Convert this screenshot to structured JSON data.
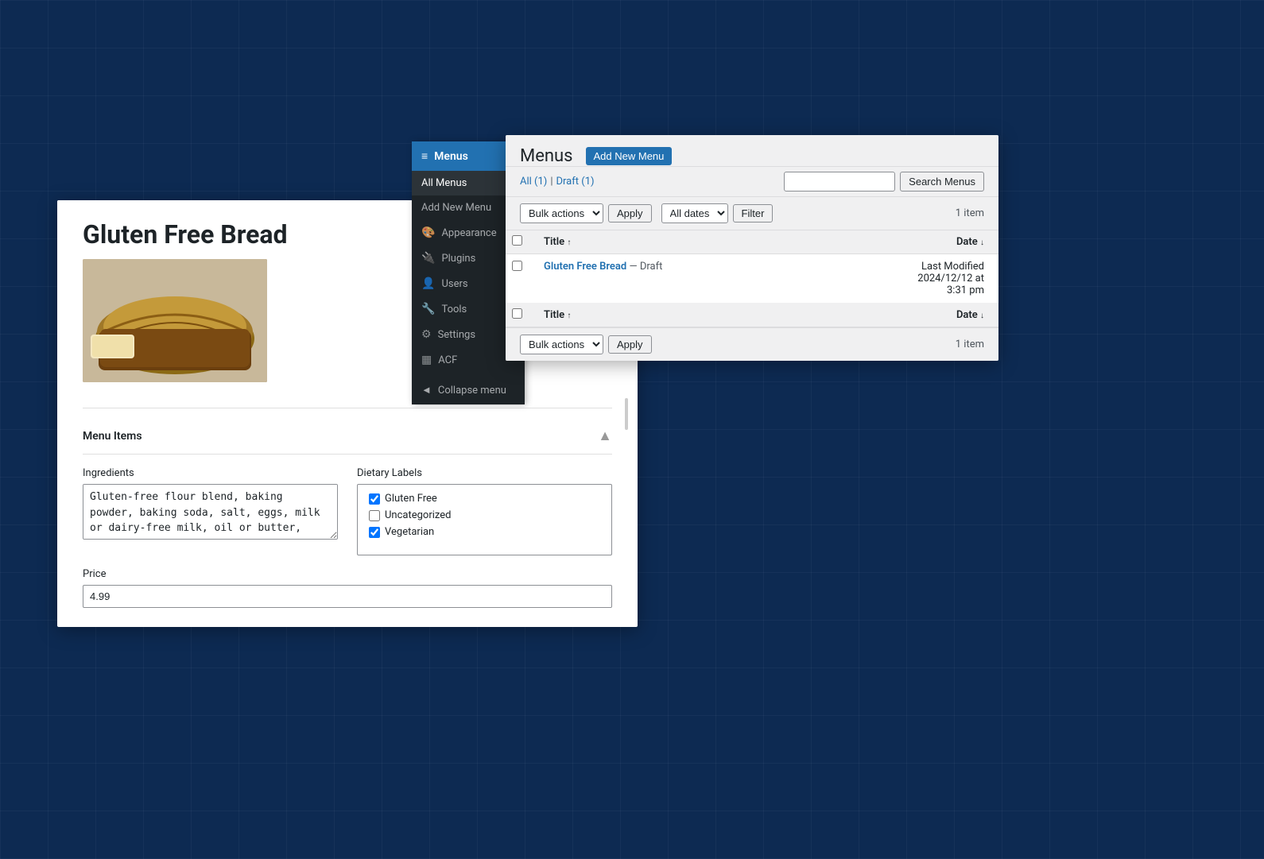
{
  "background": {
    "color": "#0d2a52"
  },
  "sidebar": {
    "current_menu": "Menus",
    "top_label": "Menus",
    "items": [
      {
        "id": "all-menus",
        "label": "All Menus",
        "active": true
      },
      {
        "id": "add-new-menu",
        "label": "Add New Menu",
        "active": false
      }
    ],
    "nav_items": [
      {
        "id": "appearance",
        "label": "Appearance",
        "icon": "🎨"
      },
      {
        "id": "plugins",
        "label": "Plugins",
        "icon": "🔌"
      },
      {
        "id": "users",
        "label": "Users",
        "icon": "👤"
      },
      {
        "id": "tools",
        "label": "Tools",
        "icon": "🔧"
      },
      {
        "id": "settings",
        "label": "Settings",
        "icon": "⚙"
      },
      {
        "id": "acf",
        "label": "ACF",
        "icon": "▦"
      }
    ],
    "collapse_label": "Collapse menu"
  },
  "menus_page": {
    "title": "Menus",
    "add_new_label": "Add New Menu",
    "subnav": {
      "all_label": "All",
      "all_count": 1,
      "draft_label": "Draft",
      "draft_count": 1
    },
    "search_placeholder": "",
    "search_button": "Search Menus",
    "toolbar_top": {
      "bulk_label": "Bulk actions",
      "apply_label": "Apply",
      "date_label": "All dates",
      "filter_label": "Filter",
      "item_count": "1 item"
    },
    "table": {
      "columns": [
        {
          "id": "title",
          "label": "Title",
          "sortable": true
        },
        {
          "id": "date",
          "label": "Date",
          "sortable": true
        }
      ],
      "rows": [
        {
          "id": 1,
          "title": "Gluten Free Bread",
          "status": "Draft",
          "date_label": "Last Modified",
          "date_value": "2024/12/12 at 3:31 pm"
        }
      ]
    },
    "toolbar_bottom": {
      "bulk_label": "Bulk actions",
      "apply_label": "Apply",
      "item_count": "1 item"
    }
  },
  "post_edit": {
    "title": "Gluten Free Bread",
    "metabox": {
      "title": "Menu Items",
      "fields": {
        "ingredients_label": "Ingredients",
        "ingredients_value": "Gluten-free flour blend, baking powder, baking soda, salt, eggs, milk or dairy-free milk, oil or butter, sugar or honey, water",
        "dietary_label": "Dietary Labels",
        "dietary_options": [
          {
            "id": "gluten-free",
            "label": "Gluten Free",
            "checked": true
          },
          {
            "id": "uncategorized",
            "label": "Uncategorized",
            "checked": false
          },
          {
            "id": "vegetarian",
            "label": "Vegetarian",
            "checked": true
          }
        ],
        "price_label": "Price",
        "price_value": "4.99"
      }
    }
  }
}
